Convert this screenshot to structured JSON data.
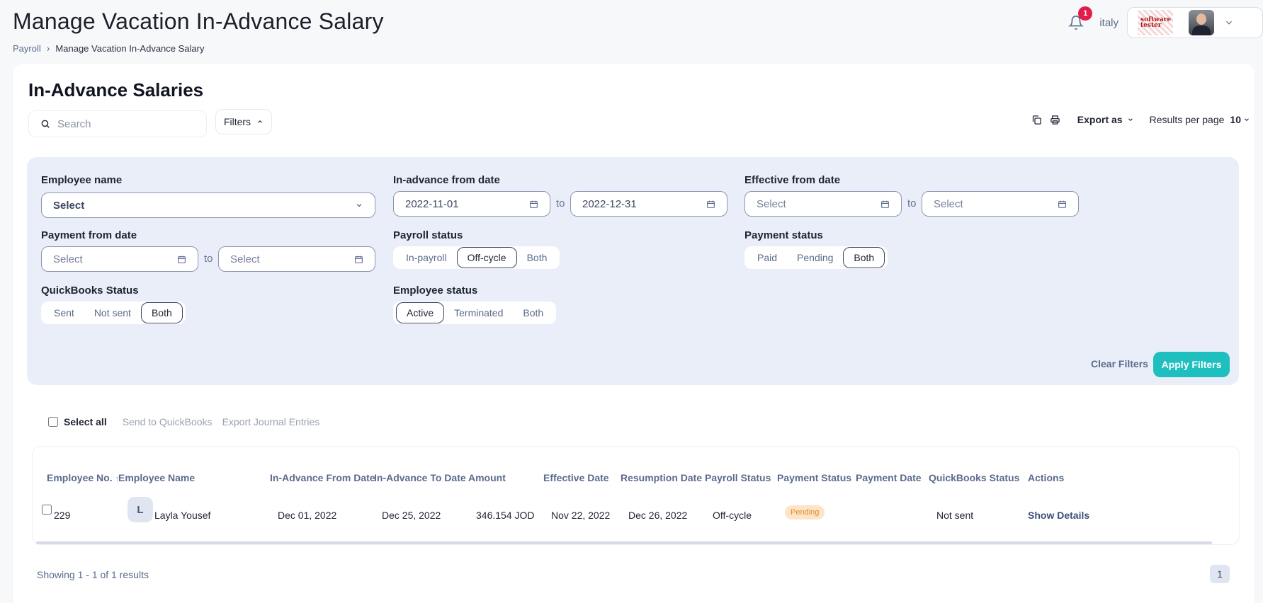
{
  "header": {
    "title": "Manage Vacation In-Advance Salary",
    "breadcrumb": {
      "parent": "Payroll",
      "current": "Manage Vacation In-Advance Salary"
    },
    "notifications_count": "1",
    "company_name": "italy",
    "logo_text": "software tester"
  },
  "card": {
    "title": "In-Advance Salaries",
    "search_placeholder": "Search",
    "filters_label": "Filters",
    "export_label": "Export as",
    "results_per_page_label": "Results per page",
    "results_per_page_value": "10"
  },
  "filters": {
    "employee_name": {
      "label": "Employee name",
      "value": "Select"
    },
    "inadvance_from": {
      "label": "In-advance from date",
      "from": "2022-11-01",
      "to": "2022-12-31"
    },
    "effective_from": {
      "label": "Effective from date",
      "from": "Select",
      "to": "Select"
    },
    "payment_from": {
      "label": "Payment from date",
      "from": "Select",
      "to": "Select"
    },
    "to_text": "to",
    "payroll_status": {
      "label": "Payroll status",
      "options": [
        "In-payroll",
        "Off-cycle",
        "Both"
      ],
      "selected": "Off-cycle"
    },
    "payment_status": {
      "label": "Payment status",
      "options": [
        "Paid",
        "Pending",
        "Both"
      ],
      "selected": "Both"
    },
    "quickbooks_status": {
      "label": "QuickBooks Status",
      "options": [
        "Sent",
        "Not sent",
        "Both"
      ],
      "selected": "Both"
    },
    "employee_status": {
      "label": "Employee status",
      "options": [
        "Active",
        "Terminated",
        "Both"
      ],
      "selected": "Active"
    },
    "clear_label": "Clear Filters",
    "apply_label": "Apply Filters"
  },
  "bulk": {
    "select_all": "Select all",
    "send_quickbooks": "Send to QuickBooks",
    "export_journal": "Export Journal Entries"
  },
  "table": {
    "columns": [
      "Employee No.",
      "Employee Name",
      "In-Advance From Date",
      "In-Advance To Date",
      "Amount",
      "Effective Date",
      "Resumption Date",
      "Payroll Status",
      "Payment Status",
      "Payment Date",
      "QuickBooks Status",
      "Actions"
    ],
    "rows": [
      {
        "employee_no": "229",
        "initial": "L",
        "employee_name": "Layla Yousef",
        "from_date": "Dec 01, 2022",
        "to_date": "Dec 25, 2022",
        "amount": "346.154 JOD",
        "effective_date": "Nov 22, 2022",
        "resumption_date": "Dec 26, 2022",
        "payroll_status": "Off-cycle",
        "payment_status": "Pending",
        "payment_date": "",
        "quickbooks_status": "Not sent",
        "action": "Show Details"
      }
    ]
  },
  "pagination": {
    "showing": "Showing 1 - 1 of 1 results",
    "page": "1"
  },
  "colors": {
    "accent": "#1fbfbf",
    "filter_bg": "#e9eef9",
    "pending_bg": "#fde4c7",
    "pending_text": "#e08a26",
    "badge": "#e11d48"
  }
}
